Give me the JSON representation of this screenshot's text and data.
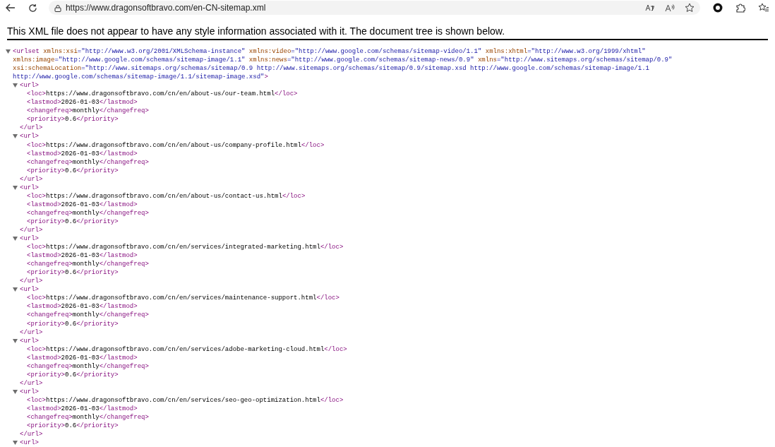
{
  "browser": {
    "url": "https://www.dragonsoftbravo.com/en-CN-sitemap.xml"
  },
  "notice": "This XML file does not appear to have any style information associated with it. The document tree is shown below.",
  "xml": {
    "expanded": true,
    "open": [
      {
        "kind": "tag",
        "text": "<urlset"
      },
      {
        "kind": "attr",
        "text": " xmlns:xsi"
      },
      {
        "kind": "value",
        "text": "=\"http://www.w3.org/2001/XMLSchema-instance\""
      },
      {
        "kind": "attr",
        "text": " xmlns:video"
      },
      {
        "kind": "value",
        "text": "=\"http://www.google.com/schemas/sitemap-video/1.1\""
      },
      {
        "kind": "attr",
        "text": " xmlns:xhtml"
      },
      {
        "kind": "value",
        "text": "=\"http://www.w3.org/1999/xhtml\""
      },
      {
        "kind": "attr",
        "text": " xmlns:image"
      },
      {
        "kind": "value",
        "text": "=\"http://www.google.com/schemas/sitemap-image/1.1\""
      },
      {
        "kind": "attr",
        "text": " xmlns:news"
      },
      {
        "kind": "value",
        "text": "=\"http://www.google.com/schemas/sitemap-news/0.9\""
      },
      {
        "kind": "attr",
        "text": " xmlns"
      },
      {
        "kind": "value",
        "text": "=\"http://www.sitemaps.org/schemas/sitemap/0.9\""
      },
      {
        "kind": "attr",
        "text": " xsi:schemaLocation"
      },
      {
        "kind": "value",
        "text": "=\"http://www.sitemaps.org/schemas/sitemap/0.9 http://www.sitemaps.org/schemas/sitemap/0.9/sitemap.xsd http://www.google.com/schemas/sitemap-image/1.1 http://www.google.com/schemas/sitemap-image/1.1/sitemap-image.xsd\""
      },
      {
        "kind": "tag",
        "text": ">"
      }
    ],
    "children": [
      {
        "expanded": true,
        "open": [
          {
            "kind": "tag",
            "text": "<url>"
          }
        ],
        "close": [
          {
            "kind": "tag",
            "text": "</url>"
          }
        ],
        "children": [
          {
            "line": [
              {
                "kind": "tag",
                "text": "<loc>"
              },
              {
                "kind": "text",
                "text": "https://www.dragonsoftbravo.com/cn/en/about-us/our-team.html"
              },
              {
                "kind": "tag",
                "text": "</loc>"
              }
            ]
          },
          {
            "line": [
              {
                "kind": "tag",
                "text": "<lastmod>"
              },
              {
                "kind": "text",
                "text": "2026-01-03"
              },
              {
                "kind": "tag",
                "text": "</lastmod>"
              }
            ]
          },
          {
            "line": [
              {
                "kind": "tag",
                "text": "<changefreq>"
              },
              {
                "kind": "text",
                "text": "monthly"
              },
              {
                "kind": "tag",
                "text": "</changefreq>"
              }
            ]
          },
          {
            "line": [
              {
                "kind": "tag",
                "text": "<priority>"
              },
              {
                "kind": "text",
                "text": "0.6"
              },
              {
                "kind": "tag",
                "text": "</priority>"
              }
            ]
          }
        ]
      },
      {
        "expanded": true,
        "open": [
          {
            "kind": "tag",
            "text": "<url>"
          }
        ],
        "close": [
          {
            "kind": "tag",
            "text": "</url>"
          }
        ],
        "children": [
          {
            "line": [
              {
                "kind": "tag",
                "text": "<loc>"
              },
              {
                "kind": "text",
                "text": "https://www.dragonsoftbravo.com/cn/en/about-us/company-profile.html"
              },
              {
                "kind": "tag",
                "text": "</loc>"
              }
            ]
          },
          {
            "line": [
              {
                "kind": "tag",
                "text": "<lastmod>"
              },
              {
                "kind": "text",
                "text": "2026-01-03"
              },
              {
                "kind": "tag",
                "text": "</lastmod>"
              }
            ]
          },
          {
            "line": [
              {
                "kind": "tag",
                "text": "<changefreq>"
              },
              {
                "kind": "text",
                "text": "monthly"
              },
              {
                "kind": "tag",
                "text": "</changefreq>"
              }
            ]
          },
          {
            "line": [
              {
                "kind": "tag",
                "text": "<priority>"
              },
              {
                "kind": "text",
                "text": "0.6"
              },
              {
                "kind": "tag",
                "text": "</priority>"
              }
            ]
          }
        ]
      },
      {
        "expanded": true,
        "open": [
          {
            "kind": "tag",
            "text": "<url>"
          }
        ],
        "close": [
          {
            "kind": "tag",
            "text": "</url>"
          }
        ],
        "children": [
          {
            "line": [
              {
                "kind": "tag",
                "text": "<loc>"
              },
              {
                "kind": "text",
                "text": "https://www.dragonsoftbravo.com/cn/en/about-us/contact-us.html"
              },
              {
                "kind": "tag",
                "text": "</loc>"
              }
            ]
          },
          {
            "line": [
              {
                "kind": "tag",
                "text": "<lastmod>"
              },
              {
                "kind": "text",
                "text": "2026-01-03"
              },
              {
                "kind": "tag",
                "text": "</lastmod>"
              }
            ]
          },
          {
            "line": [
              {
                "kind": "tag",
                "text": "<changefreq>"
              },
              {
                "kind": "text",
                "text": "monthly"
              },
              {
                "kind": "tag",
                "text": "</changefreq>"
              }
            ]
          },
          {
            "line": [
              {
                "kind": "tag",
                "text": "<priority>"
              },
              {
                "kind": "text",
                "text": "0.6"
              },
              {
                "kind": "tag",
                "text": "</priority>"
              }
            ]
          }
        ]
      },
      {
        "expanded": true,
        "open": [
          {
            "kind": "tag",
            "text": "<url>"
          }
        ],
        "close": [
          {
            "kind": "tag",
            "text": "</url>"
          }
        ],
        "children": [
          {
            "line": [
              {
                "kind": "tag",
                "text": "<loc>"
              },
              {
                "kind": "text",
                "text": "https://www.dragonsoftbravo.com/cn/en/services/integrated-marketing.html"
              },
              {
                "kind": "tag",
                "text": "</loc>"
              }
            ]
          },
          {
            "line": [
              {
                "kind": "tag",
                "text": "<lastmod>"
              },
              {
                "kind": "text",
                "text": "2026-01-03"
              },
              {
                "kind": "tag",
                "text": "</lastmod>"
              }
            ]
          },
          {
            "line": [
              {
                "kind": "tag",
                "text": "<changefreq>"
              },
              {
                "kind": "text",
                "text": "monthly"
              },
              {
                "kind": "tag",
                "text": "</changefreq>"
              }
            ]
          },
          {
            "line": [
              {
                "kind": "tag",
                "text": "<priority>"
              },
              {
                "kind": "text",
                "text": "0.6"
              },
              {
                "kind": "tag",
                "text": "</priority>"
              }
            ]
          }
        ]
      },
      {
        "expanded": true,
        "open": [
          {
            "kind": "tag",
            "text": "<url>"
          }
        ],
        "close": [
          {
            "kind": "tag",
            "text": "</url>"
          }
        ],
        "children": [
          {
            "line": [
              {
                "kind": "tag",
                "text": "<loc>"
              },
              {
                "kind": "text",
                "text": "https://www.dragonsoftbravo.com/cn/en/services/maintenance-support.html"
              },
              {
                "kind": "tag",
                "text": "</loc>"
              }
            ]
          },
          {
            "line": [
              {
                "kind": "tag",
                "text": "<lastmod>"
              },
              {
                "kind": "text",
                "text": "2026-01-03"
              },
              {
                "kind": "tag",
                "text": "</lastmod>"
              }
            ]
          },
          {
            "line": [
              {
                "kind": "tag",
                "text": "<changefreq>"
              },
              {
                "kind": "text",
                "text": "monthly"
              },
              {
                "kind": "tag",
                "text": "</changefreq>"
              }
            ]
          },
          {
            "line": [
              {
                "kind": "tag",
                "text": "<priority>"
              },
              {
                "kind": "text",
                "text": "0.6"
              },
              {
                "kind": "tag",
                "text": "</priority>"
              }
            ]
          }
        ]
      },
      {
        "expanded": true,
        "open": [
          {
            "kind": "tag",
            "text": "<url>"
          }
        ],
        "close": [
          {
            "kind": "tag",
            "text": "</url>"
          }
        ],
        "children": [
          {
            "line": [
              {
                "kind": "tag",
                "text": "<loc>"
              },
              {
                "kind": "text",
                "text": "https://www.dragonsoftbravo.com/cn/en/services/adobe-marketing-cloud.html"
              },
              {
                "kind": "tag",
                "text": "</loc>"
              }
            ]
          },
          {
            "line": [
              {
                "kind": "tag",
                "text": "<lastmod>"
              },
              {
                "kind": "text",
                "text": "2026-01-03"
              },
              {
                "kind": "tag",
                "text": "</lastmod>"
              }
            ]
          },
          {
            "line": [
              {
                "kind": "tag",
                "text": "<changefreq>"
              },
              {
                "kind": "text",
                "text": "monthly"
              },
              {
                "kind": "tag",
                "text": "</changefreq>"
              }
            ]
          },
          {
            "line": [
              {
                "kind": "tag",
                "text": "<priority>"
              },
              {
                "kind": "text",
                "text": "0.6"
              },
              {
                "kind": "tag",
                "text": "</priority>"
              }
            ]
          }
        ]
      },
      {
        "expanded": true,
        "open": [
          {
            "kind": "tag",
            "text": "<url>"
          }
        ],
        "close": [
          {
            "kind": "tag",
            "text": "</url>"
          }
        ],
        "children": [
          {
            "line": [
              {
                "kind": "tag",
                "text": "<loc>"
              },
              {
                "kind": "text",
                "text": "https://www.dragonsoftbravo.com/cn/en/services/seo-geo-optimization.html"
              },
              {
                "kind": "tag",
                "text": "</loc>"
              }
            ]
          },
          {
            "line": [
              {
                "kind": "tag",
                "text": "<lastmod>"
              },
              {
                "kind": "text",
                "text": "2026-01-03"
              },
              {
                "kind": "tag",
                "text": "</lastmod>"
              }
            ]
          },
          {
            "line": [
              {
                "kind": "tag",
                "text": "<changefreq>"
              },
              {
                "kind": "text",
                "text": "monthly"
              },
              {
                "kind": "tag",
                "text": "</changefreq>"
              }
            ]
          },
          {
            "line": [
              {
                "kind": "tag",
                "text": "<priority>"
              },
              {
                "kind": "text",
                "text": "0.6"
              },
              {
                "kind": "tag",
                "text": "</priority>"
              }
            ]
          }
        ]
      },
      {
        "expanded": true,
        "open": [
          {
            "kind": "tag",
            "text": "<url>"
          }
        ]
      }
    ]
  }
}
